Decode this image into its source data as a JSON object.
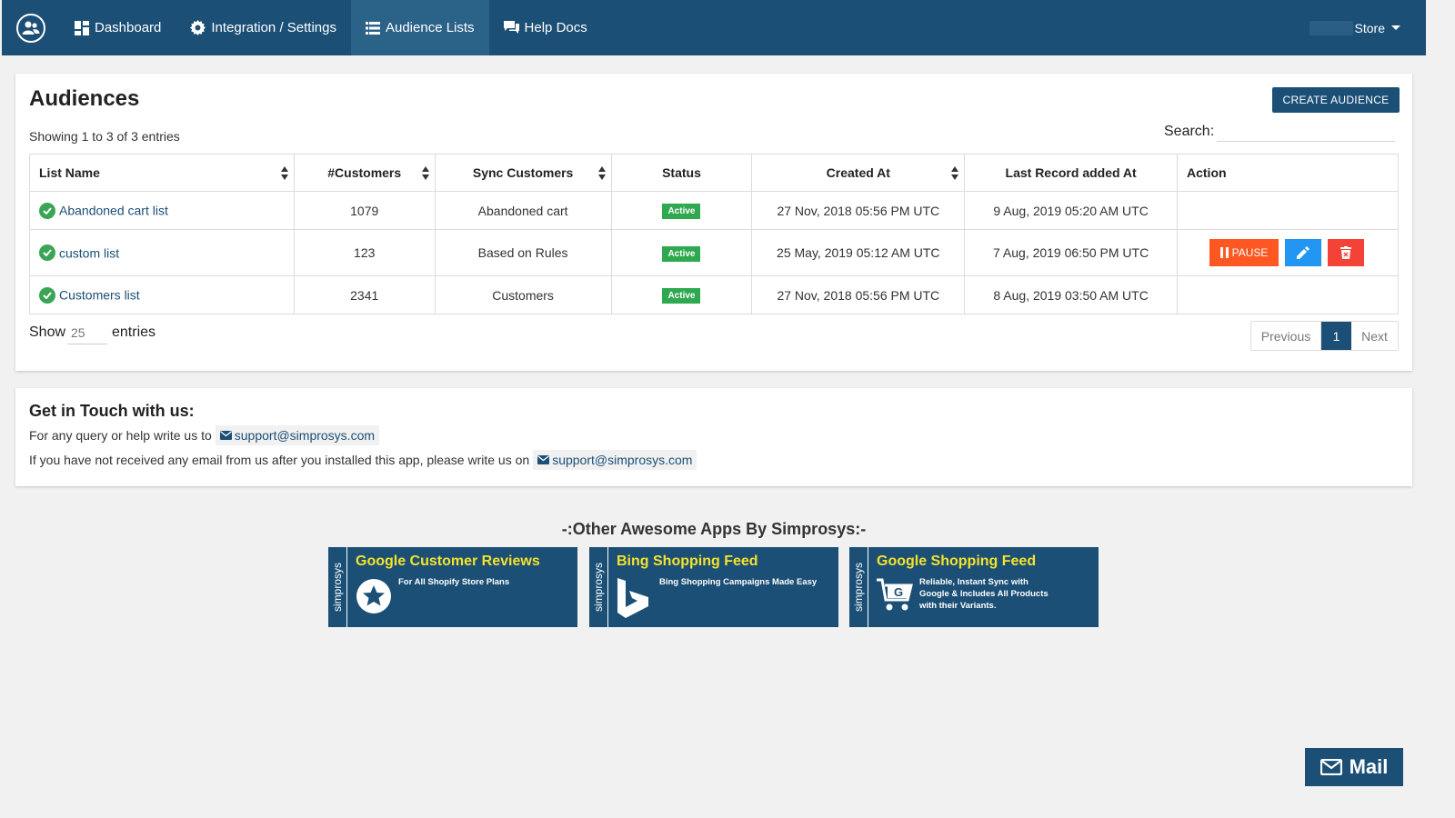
{
  "nav": {
    "items": [
      {
        "label": "Dashboard",
        "icon": "dashboard-icon"
      },
      {
        "label": "Integration / Settings",
        "icon": "gear-icon"
      },
      {
        "label": "Audience Lists",
        "icon": "list-icon"
      },
      {
        "label": "Help Docs",
        "icon": "chat-icon"
      }
    ],
    "active_index": 2,
    "store_label": "Store"
  },
  "audiences": {
    "title": "Audiences",
    "create_button": "CREATE AUDIENCE",
    "showing_text": "Showing 1 to 3 of 3 entries",
    "search_label": "Search:",
    "search_value": "",
    "columns": [
      "List Name",
      "#Customers",
      "Sync Customers",
      "Status",
      "Created At",
      "Last Record added At",
      "Action"
    ],
    "rows": [
      {
        "name": "Abandoned cart list",
        "customers": "1079",
        "sync": "Abandoned cart",
        "status": "Active",
        "created": "27 Nov, 2018 05:56 PM UTC",
        "last": "9 Aug, 2019 05:20 AM UTC"
      },
      {
        "name": "custom list",
        "customers": "123",
        "sync": "Based on Rules",
        "status": "Active",
        "created": "25 May, 2019 05:12 AM UTC",
        "last": "7 Aug, 2019 06:50 PM UTC",
        "pause_label": "PAUSE"
      },
      {
        "name": "Customers list",
        "customers": "2341",
        "sync": "Customers",
        "status": "Active",
        "created": "27 Nov, 2018 05:56 PM UTC",
        "last": "8 Aug, 2019 03:50 AM UTC"
      }
    ],
    "show_label": "Show",
    "page_size": "25",
    "entries_label": "entries",
    "pager": {
      "previous": "Previous",
      "current": "1",
      "next": "Next"
    }
  },
  "contact": {
    "title": "Get in Touch with us:",
    "line1": "For any query or help write us to",
    "line2": "If you have not received any email from us after you installed this app, please write us on",
    "email": "support@simprosys.com"
  },
  "other_apps": {
    "title": "-:Other Awesome Apps By Simprosys:-",
    "brand": "simprosys",
    "banners": [
      {
        "title": "Google Customer Reviews",
        "subtitle": "For All Shopify Store Plans",
        "icon": "star-badge-icon"
      },
      {
        "title": "Bing Shopping Feed",
        "subtitle": "Bing Shopping Campaigns Made Easy",
        "icon": "bing-logo-icon"
      },
      {
        "title": "Google Shopping Feed",
        "subtitle_lines": [
          "Reliable, Instant Sync with",
          "Google & Includes All Products",
          "with their Variants."
        ],
        "icon": "cart-g-icon"
      }
    ]
  },
  "mail_button": "Mail",
  "colors": {
    "primary": "#1b4f76",
    "active_badge": "#2fa84f",
    "pause": "#ff5722",
    "edit": "#2196f3",
    "delete": "#f44336",
    "banner_title": "#f5e22b"
  }
}
